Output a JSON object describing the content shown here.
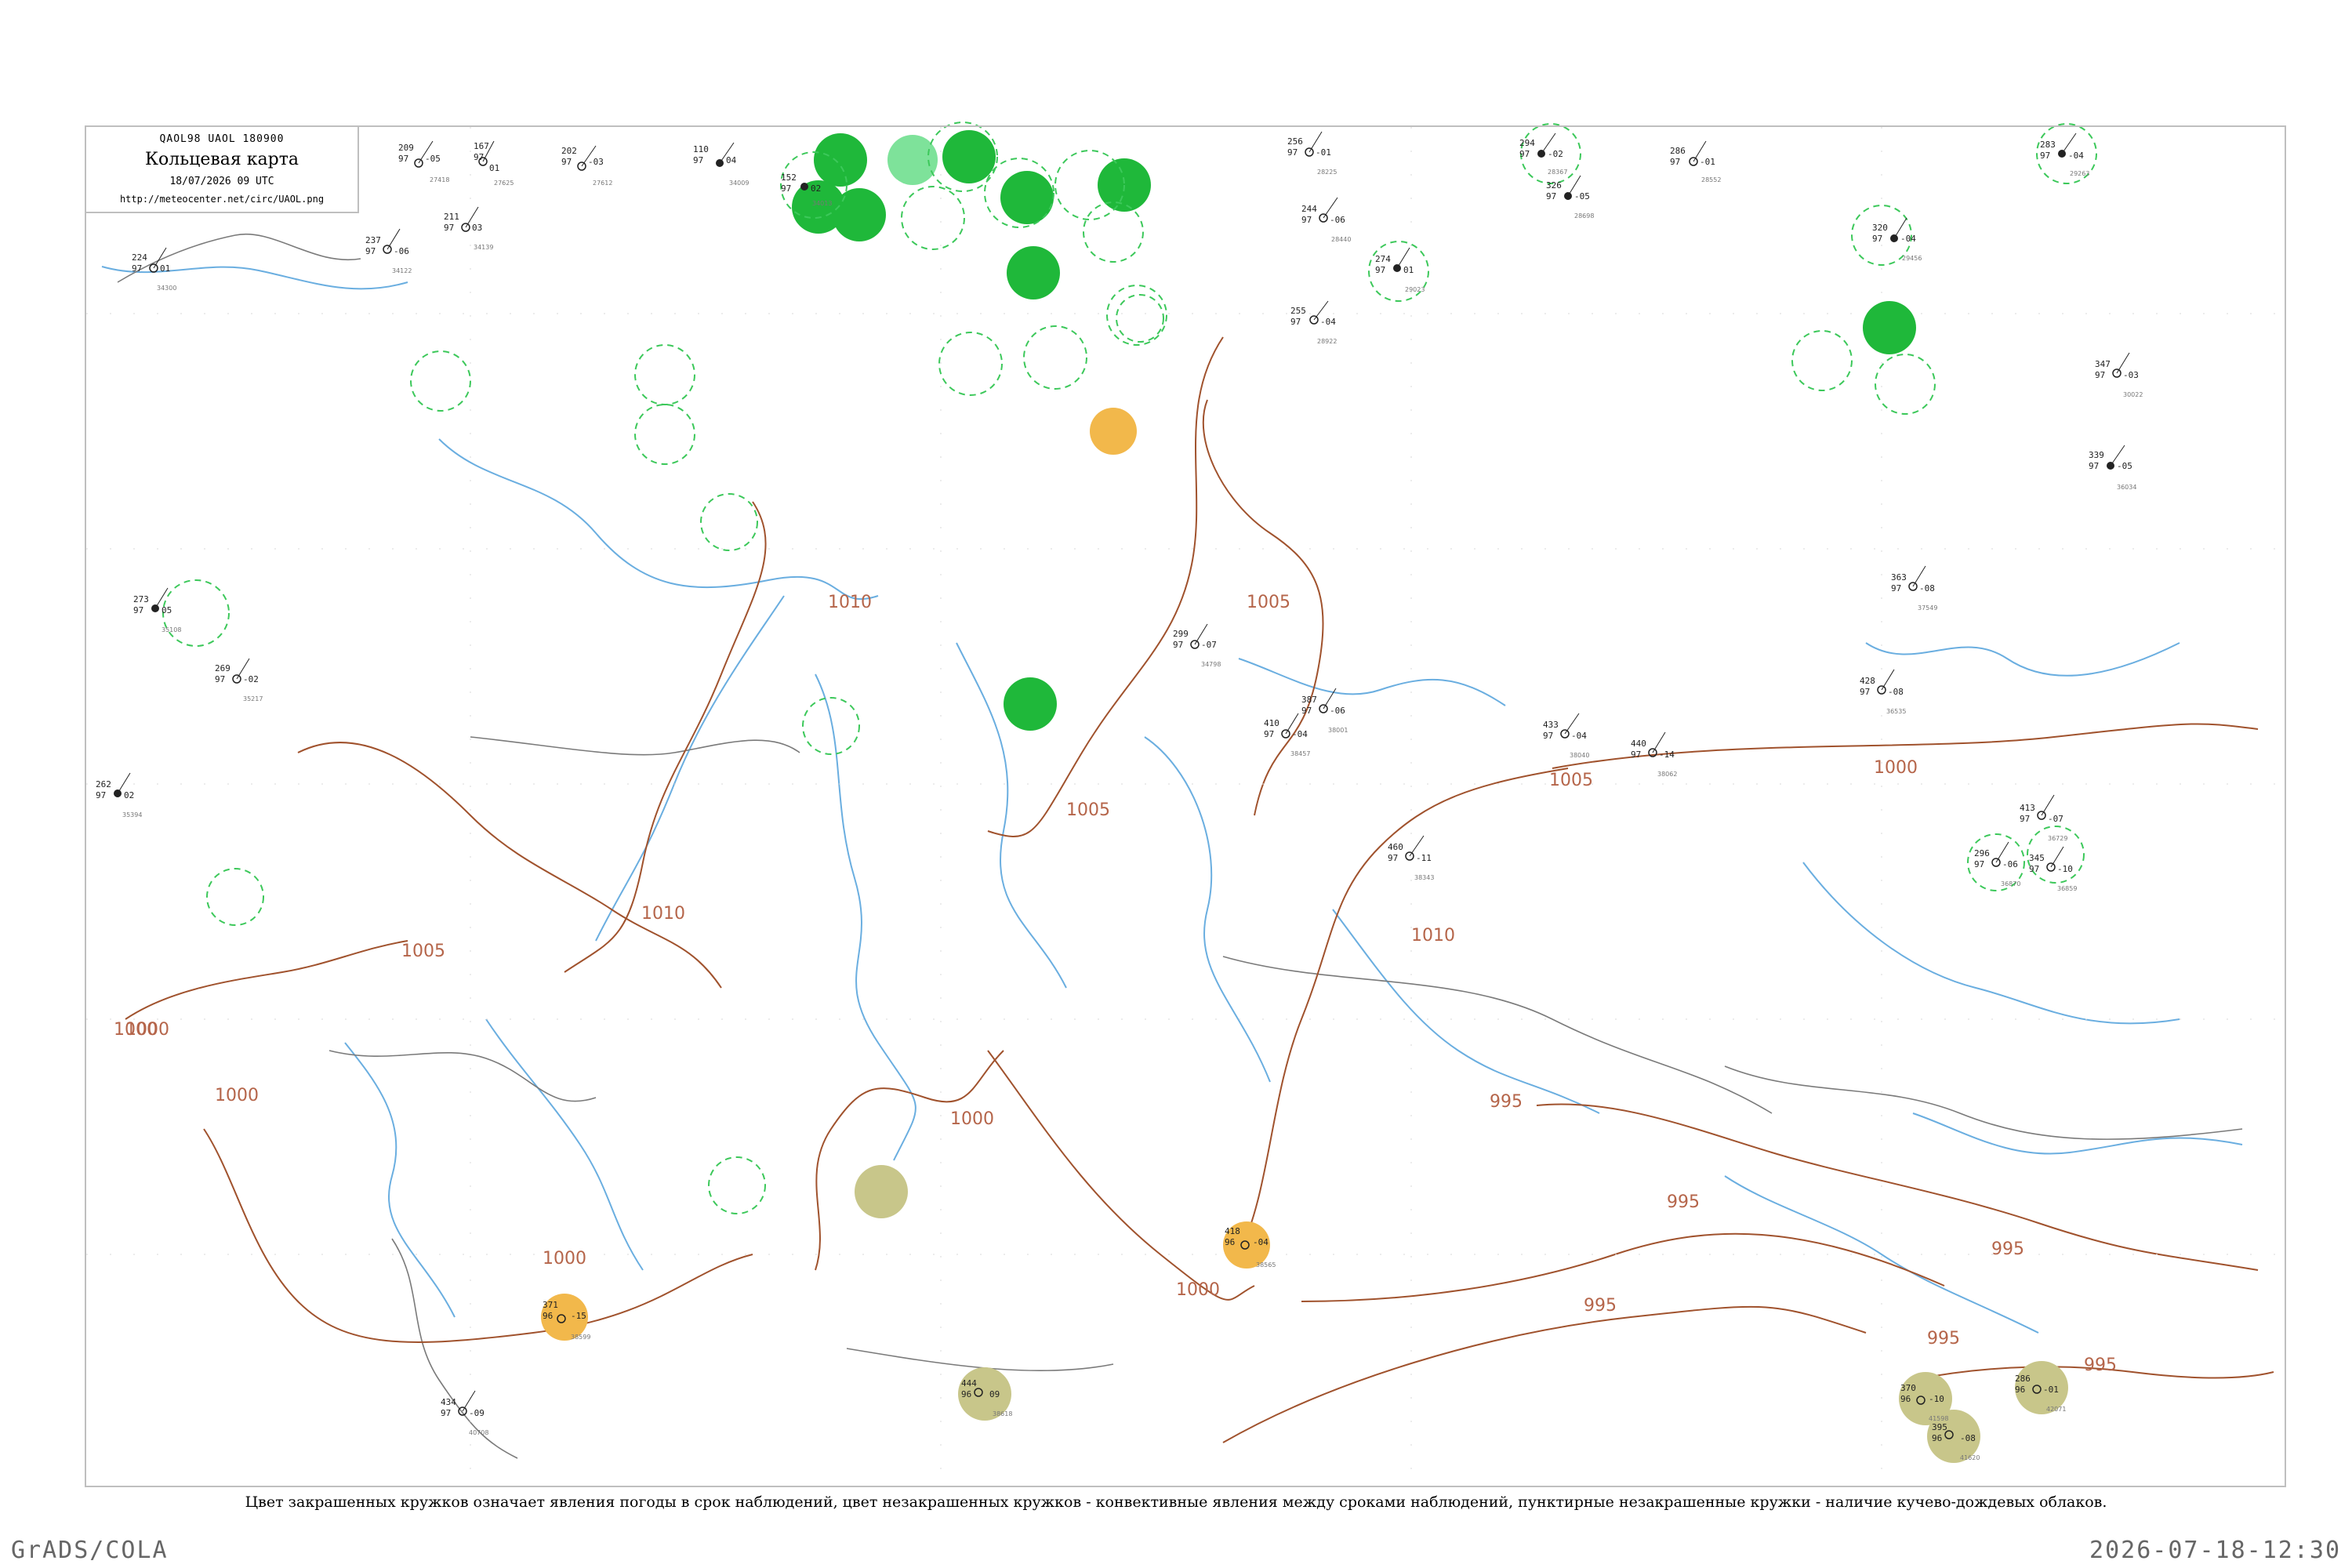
{
  "header": {
    "code_line": "QAOL98  UAOL  180900",
    "title": "Кольцевая карта",
    "date_line": "18/07/2026 09 UTC",
    "url": "http://meteocenter.net/circ/UAOL.png"
  },
  "caption": "Цвет закрашенных кружков означает явления погоды в срок наблюдений, цвет незакрашенных кружков - конвективные явления между сроками наблюдений, пунктирные незакрашенные кружки - наличие кучево-дождевых облаков.",
  "footer": {
    "left": "GrADS/COLA",
    "right": "2026-07-18-12:30"
  },
  "colors": {
    "frame": "#bfbfbf",
    "isobar": "#a0522d",
    "river": "#6aaee0",
    "border": "#999999",
    "rain_fill": "#1fb83a",
    "rain_light_fill": "#7ee29a",
    "cb_dashed": "#3cc85a",
    "haze_fill": "#f2b84b",
    "dust_fill": "#c8c68a"
  },
  "isobar_labels": [
    "1010",
    "1005",
    "1010",
    "1005",
    "1000",
    "1005",
    "1000",
    "1000",
    "1000",
    "995",
    "995",
    "995",
    "995",
    "995",
    "1000",
    "1005",
    "1000",
    "1010",
    "995",
    "1000"
  ],
  "stations": [
    {
      "t": "209",
      "p": "97",
      "d": "-05",
      "id": "27418"
    },
    {
      "t": "202",
      "p": "97",
      "d": "-03",
      "id": "27612"
    },
    {
      "t": "167",
      "p": "97",
      "d": "01",
      "id": "27625"
    },
    {
      "t": "110",
      "p": "97",
      "d": "04",
      "id": "34009"
    },
    {
      "t": "152",
      "p": "97",
      "d": "02",
      "id": "34013"
    },
    {
      "t": "256",
      "p": "97",
      "d": "-01",
      "id": "28225"
    },
    {
      "t": "294",
      "p": "97",
      "d": "-02",
      "id": "28367"
    },
    {
      "t": "286",
      "p": "97",
      "d": "-01",
      "id": "28552"
    },
    {
      "t": "283",
      "p": "97",
      "d": "-04",
      "id": "29263"
    },
    {
      "t": "224",
      "p": "97",
      "d": "01",
      "id": "34300"
    },
    {
      "t": "237",
      "p": "97",
      "d": "-06",
      "id": "34122"
    },
    {
      "t": "211",
      "p": "97",
      "d": "03",
      "id": "34139"
    },
    {
      "t": "244",
      "p": "97",
      "d": "-06",
      "id": "28440"
    },
    {
      "t": "326",
      "p": "97",
      "d": "-05",
      "id": "28698"
    },
    {
      "t": "255",
      "p": "97",
      "d": "-04",
      "id": "28922"
    },
    {
      "t": "320",
      "p": "97",
      "d": "-04",
      "id": "29456"
    },
    {
      "t": "274",
      "p": "97",
      "d": "01",
      "id": "29023"
    },
    {
      "t": "347",
      "p": "97",
      "d": "-03",
      "id": "30022"
    },
    {
      "t": "339",
      "p": "97",
      "d": "-05",
      "id": "36034"
    },
    {
      "t": "273",
      "p": "97",
      "d": "05",
      "id": "35108"
    },
    {
      "t": "269",
      "p": "97",
      "d": "-02",
      "id": "35217"
    },
    {
      "t": "262",
      "p": "97",
      "d": "02",
      "id": "35394"
    },
    {
      "t": "299",
      "p": "97",
      "d": "-07",
      "id": "34798"
    },
    {
      "t": "387",
      "p": "97",
      "d": "-06",
      "id": "38001"
    },
    {
      "t": "433",
      "p": "97",
      "d": "-04",
      "id": "38040"
    },
    {
      "t": "460",
      "p": "97",
      "d": "-11",
      "id": "38343"
    },
    {
      "t": "410",
      "p": "97",
      "d": "-04",
      "id": "38457"
    },
    {
      "t": "363",
      "p": "97",
      "d": "-08",
      "id": "37549"
    },
    {
      "t": "418",
      "p": "96",
      "d": "-04",
      "id": "38565"
    },
    {
      "t": "444",
      "p": "96",
      "d": "09",
      "id": "38618"
    },
    {
      "t": "371",
      "p": "96",
      "d": "-15",
      "id": "38599"
    },
    {
      "t": "434",
      "p": "97",
      "d": "-09",
      "id": "40708"
    },
    {
      "t": "370",
      "p": "96",
      "d": "-10",
      "id": "41598"
    },
    {
      "t": "286",
      "p": "96",
      "d": "-01",
      "id": "42071"
    },
    {
      "t": "395",
      "p": "96",
      "d": "-08",
      "id": "41620"
    },
    {
      "t": "345",
      "p": "97",
      "d": "-10",
      "id": "36859"
    },
    {
      "t": "440",
      "p": "97",
      "d": "-14",
      "id": "38062"
    },
    {
      "t": "428",
      "p": "97",
      "d": "-08",
      "id": "36535"
    },
    {
      "t": "296",
      "p": "97",
      "d": "-06",
      "id": "36870"
    },
    {
      "t": "413",
      "p": "97",
      "d": "-07",
      "id": "36729"
    }
  ]
}
